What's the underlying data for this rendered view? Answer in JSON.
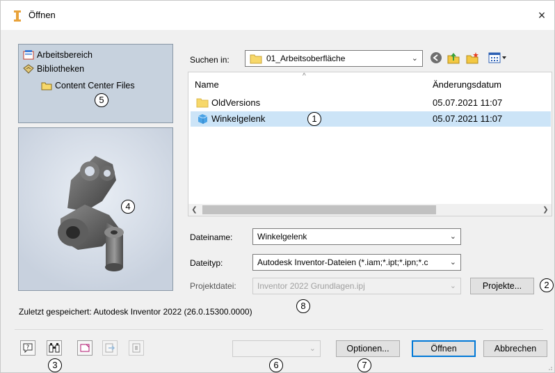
{
  "window": {
    "title": "Öffnen",
    "close_label": "×"
  },
  "locations": [
    {
      "label": "Arbeitsbereich"
    },
    {
      "label": "Bibliotheken"
    },
    {
      "label": "Content Center Files"
    }
  ],
  "search_in": {
    "label": "Suchen in:",
    "value": "01_Arbeitsoberfläche"
  },
  "filelist": {
    "columns": {
      "name": "Name",
      "date": "Änderungsdatum"
    },
    "rows": [
      {
        "name": "OldVersions",
        "date": "05.07.2021 11:07",
        "type": "folder"
      },
      {
        "name": "Winkelgelenk",
        "date": "05.07.2021 11:07",
        "type": "part",
        "selected": true
      }
    ]
  },
  "filename": {
    "label": "Dateiname:",
    "value": "Winkelgelenk"
  },
  "filetype": {
    "label": "Dateityp:",
    "value": "Autodesk Inventor-Dateien (*.iam;*.ipt;*.ipn;*.c"
  },
  "project": {
    "label": "Projektdatei:",
    "value": "Inventor 2022 Grundlagen.ipj",
    "button": "Projekte..."
  },
  "last_saved": "Zuletzt gespeichert: Autodesk Inventor 2022 (26.0.15300.0000)",
  "buttons": {
    "options": "Optionen...",
    "open": "Öffnen",
    "cancel": "Abbrechen"
  },
  "badges": [
    "1",
    "2",
    "3",
    "4",
    "5",
    "6",
    "7",
    "8"
  ],
  "colors": {
    "accent": "#0078d7",
    "selection": "#cce4f7",
    "panel": "#c7d2de"
  }
}
